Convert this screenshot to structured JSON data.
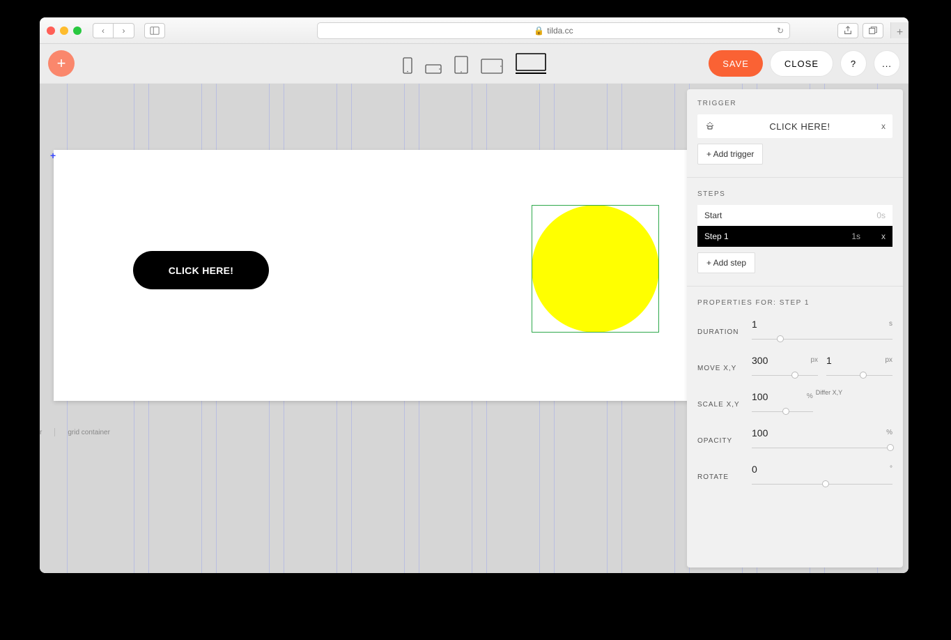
{
  "browser": {
    "url_host": "tilda.cc",
    "lock": "🔒"
  },
  "toolbar": {
    "save": "SAVE",
    "close": "CLOSE",
    "help": "?",
    "more": "..."
  },
  "canvas": {
    "button_label": "CLICK HERE!",
    "footer_r": "r",
    "footer_grid": "grid container"
  },
  "panel": {
    "trigger_label": "TRIGGER",
    "trigger_name": "CLICK HERE!",
    "add_trigger": "+ Add trigger",
    "steps_label": "STEPS",
    "step_start": "Start",
    "step_start_dur": "0s",
    "step1": "Step 1",
    "step1_dur": "1s",
    "add_step": "+ Add step",
    "props_label": "PROPERTIES FOR: STEP 1",
    "duration_label": "DURATION",
    "duration_val": "1",
    "duration_unit": "s",
    "move_label": "MOVE X,Y",
    "move_x": "300",
    "move_y": "1",
    "px": "px",
    "scale_label": "SCALE X,Y",
    "scale_val": "100",
    "pct": "%",
    "differ": "Differ X,Y",
    "opacity_label": "OPACITY",
    "opacity_val": "100",
    "rotate_label": "ROTATE",
    "rotate_val": "0",
    "deg": "°",
    "close_x": "x"
  }
}
